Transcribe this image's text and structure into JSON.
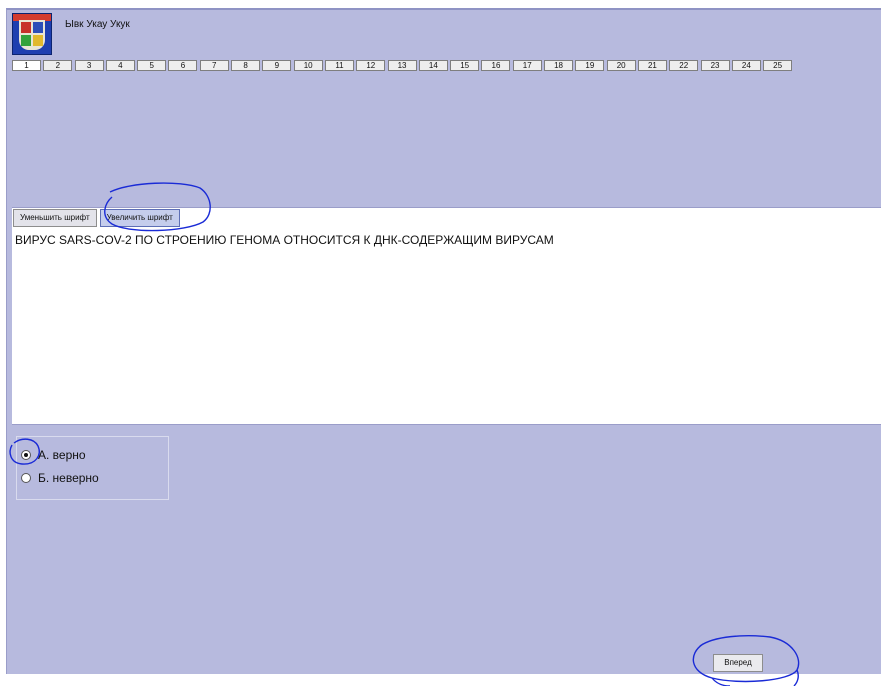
{
  "header": {
    "title": "Ывк Укау Укук",
    "logo_icon": "coat-of-arms-icon"
  },
  "question_nav": [
    "1",
    "2",
    "3",
    "4",
    "5",
    "6",
    "7",
    "8",
    "9",
    "10",
    "11",
    "12",
    "13",
    "14",
    "15",
    "16",
    "17",
    "18",
    "19",
    "20",
    "21",
    "22",
    "23",
    "24",
    "25"
  ],
  "font_controls": {
    "decrease_label": "Уменьшить шрифт",
    "increase_label": "Увеличить шрифт"
  },
  "question": {
    "text": "ВИРУС SARS-COV-2 ПО СТРОЕНИЮ ГЕНОМА ОТНОСИТСЯ К ДНК-СОДЕРЖАЩИМ ВИРУСАМ"
  },
  "answers": {
    "options": [
      {
        "label": "А. верно",
        "selected": true
      },
      {
        "label": "Б. неверно",
        "selected": false
      }
    ]
  },
  "footer": {
    "next_label": "Вперед"
  },
  "colors": {
    "background": "#b7bade",
    "annotation_ink": "#1a2bd6"
  }
}
